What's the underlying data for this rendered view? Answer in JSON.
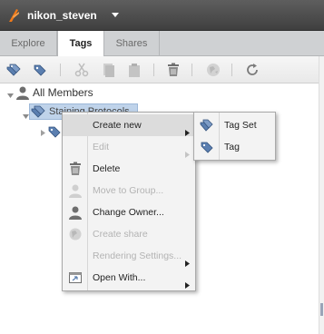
{
  "header": {
    "username": "nikon_steven"
  },
  "tabs": [
    {
      "label": "Explore",
      "active": false
    },
    {
      "label": "Tags",
      "active": true
    },
    {
      "label": "Shares",
      "active": false
    }
  ],
  "toolbar": {
    "icons": [
      "tagset-icon",
      "tag-icon",
      "cut-icon",
      "copy-icon",
      "paste-icon",
      "delete-icon",
      "share-icon",
      "refresh-icon"
    ]
  },
  "tree": {
    "root_label": "All Members",
    "selected_label": "Staining Protocols"
  },
  "context_menu": {
    "items": [
      {
        "label": "Create new",
        "enabled": true,
        "submenu": true,
        "icon": ""
      },
      {
        "label": "Edit",
        "enabled": false,
        "submenu": true,
        "icon": ""
      },
      {
        "label": "Delete",
        "enabled": true,
        "submenu": false,
        "icon": "delete-icon"
      },
      {
        "label": "Move to Group...",
        "enabled": false,
        "submenu": false,
        "icon": "user-icon"
      },
      {
        "label": "Change Owner...",
        "enabled": true,
        "submenu": false,
        "icon": "user-icon"
      },
      {
        "label": "Create share",
        "enabled": false,
        "submenu": false,
        "icon": "share-icon"
      },
      {
        "label": "Rendering Settings...",
        "enabled": false,
        "submenu": true,
        "icon": ""
      },
      {
        "label": "Open With...",
        "enabled": true,
        "submenu": true,
        "icon": "open-with-icon"
      }
    ]
  },
  "submenu": {
    "items": [
      {
        "label": "Tag Set",
        "icon": "tagset-icon"
      },
      {
        "label": "Tag",
        "icon": "tag-icon"
      }
    ]
  },
  "colors": {
    "header_bg": "#4a4a4a",
    "accent_orange": "#f07a1a",
    "tag_blue": "#5b7fb0",
    "selection": "#bfd3ea"
  }
}
